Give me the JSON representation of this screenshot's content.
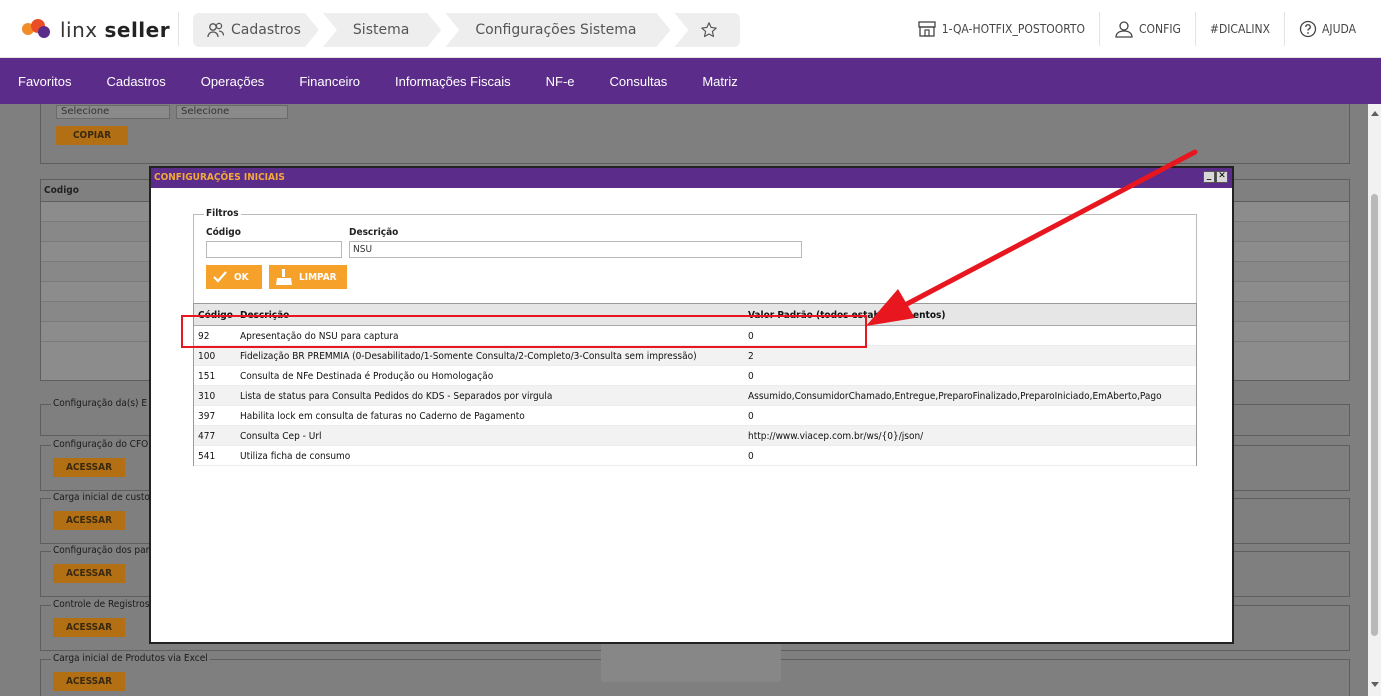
{
  "brand": {
    "name_light": "linx",
    "name_bold": "seller"
  },
  "breadcrumb": [
    {
      "label": "Cadastros",
      "icon": "users-icon"
    },
    {
      "label": "Sistema"
    },
    {
      "label": "Configurações Sistema"
    }
  ],
  "topright": {
    "store": "1-QA-HOTFIX_POSTOORTO",
    "user": "CONFIG",
    "tag": "#DICALINX",
    "help": "AJUDA"
  },
  "nav": [
    "Favoritos",
    "Cadastros",
    "Operações",
    "Financeiro",
    "Informações Fiscais",
    "NF-e",
    "Consultas",
    "Matriz"
  ],
  "background": {
    "select1": "Selecione",
    "select2": "Selecione",
    "copy_button": "COPIAR",
    "grid_header": "Codigo",
    "sections": [
      {
        "title": "Configuração da(s) E",
        "button": ""
      },
      {
        "title": "Configuração do CFO",
        "button": "ACESSAR"
      },
      {
        "title": "Carga inicial de custo",
        "button": "ACESSAR"
      },
      {
        "title": "Configuração dos par",
        "button": "ACESSAR"
      },
      {
        "title": "Controle de Registros",
        "button": "ACESSAR"
      },
      {
        "title": "Carga inicial de Produtos via Excel",
        "button": "ACESSAR"
      }
    ]
  },
  "modal": {
    "title": "CONFIGURAÇÕES INICIAIS",
    "filters": {
      "legend": "Filtros",
      "code_label": "Código",
      "code_value": "",
      "desc_label": "Descrição",
      "desc_value": "NSU",
      "ok_button": "OK",
      "clear_button": "LIMPAR"
    },
    "grid": {
      "columns": {
        "code": "Código",
        "desc": "Descrição",
        "value": "Valor Padrão (todos estabelecimentos)"
      },
      "rows": [
        {
          "code": "92",
          "desc": "Apresentação do NSU para captura",
          "value": "0"
        },
        {
          "code": "100",
          "desc": "Fidelização BR PREMMIA (0-Desabilitado/1-Somente Consulta/2-Completo/3-Consulta sem impressão)",
          "value": "2"
        },
        {
          "code": "151",
          "desc": "Consulta de NFe Destinada é Produção ou Homologação",
          "value": "0"
        },
        {
          "code": "310",
          "desc": "Lista de status para Consulta Pedidos do KDS - Separados por virgula",
          "value": "Assumido,ConsumidorChamado,Entregue,PreparoFinalizado,PreparoIniciado,EmAberto,Pago"
        },
        {
          "code": "397",
          "desc": "Habilita lock em consulta de faturas no Caderno de Pagamento",
          "value": "0"
        },
        {
          "code": "477",
          "desc": "Consulta Cep - Url",
          "value": "http://www.viacep.com.br/ws/{0}/json/"
        },
        {
          "code": "541",
          "desc": "Utiliza ficha de consumo",
          "value": "0"
        }
      ]
    }
  },
  "colors": {
    "brand_purple": "#5b2c8a",
    "accent_orange": "#f5a12a",
    "annotation_red": "#e8161f"
  }
}
